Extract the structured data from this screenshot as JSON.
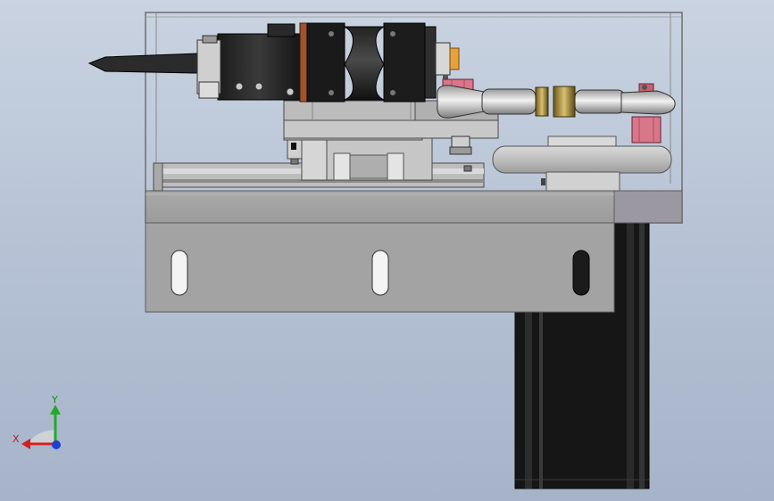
{
  "view": {
    "background_top": "#c9d3e1",
    "background_bottom": "#a6b3c9"
  },
  "triad": {
    "x_label": "X",
    "y_label": "Y",
    "x_color": "#d21f1f",
    "y_color": "#1faa2a",
    "z_color": "#1f3fd2"
  }
}
